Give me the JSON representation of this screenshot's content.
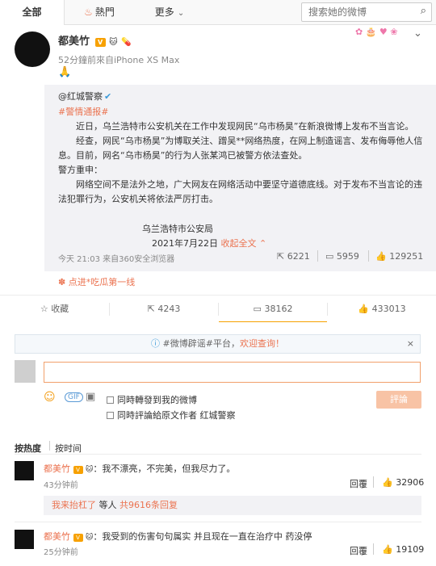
{
  "header": {
    "tabs": [
      {
        "label": "全部"
      },
      {
        "label": "熱門"
      },
      {
        "label": "更多"
      }
    ],
    "search_placeholder": "搜索她的微博"
  },
  "post": {
    "author": "都美竹",
    "meta": "52分鐘前來自iPhone XS Max",
    "text": "🙏",
    "repost": {
      "source": "@红城警察",
      "tag": "#警情通报#",
      "p1": "近日，乌兰浩特市公安机关在工作中发现网民“乌市杨昊”在新浪微博上发布不当言论。",
      "p2": "经查，网民“乌市杨昊”为博取关注、蹭吴**网络热度，在网上制造谣言、发布侮辱他人信息。目前，网名“乌市杨昊”的行为人张某鸿已被警方依法查处。",
      "p3": "警方重申：",
      "p4": "网络空间不是法外之地，广大网友在网络活动中要坚守道德底线。对于发布不当言论的违法犯罪行为，公安机关将依法严厉打击。",
      "org": "乌兰浩特市公安局",
      "date": "2021年7月22日",
      "collapse": "收起全文",
      "time_source": "今天 21:03 来自360安全浏览器",
      "repost_count": "6221",
      "comment_count": "5959",
      "like_count": "129251"
    },
    "promo": "点进*吃瓜第一线"
  },
  "actions": {
    "fav": "收藏",
    "repost": "4243",
    "comment": "38162",
    "like": "433013"
  },
  "comment_box": {
    "notice_pre": "#微博辟谣#平台，",
    "notice_link": "欢迎查询！",
    "opt1": "同時轉發到我的微博",
    "opt2": "同時評論給原文作者 红城警察",
    "submit": "評論"
  },
  "sort": {
    "hot": "按热度",
    "time": "按时间"
  },
  "comments": [
    {
      "user": "都美竹",
      "text": "：我不漂亮，不完美，但我尽力了。",
      "time": "43分钟前",
      "reply": "回覆",
      "likes": "32906"
    },
    {
      "user": "都美竹",
      "text": "：我受到的伤害句句属实 并且现在一直在治疗中 药没停",
      "time": "25分钟前",
      "reply": "回覆",
      "likes": "19109"
    }
  ],
  "reply_summary": {
    "who": "我来抬杠了",
    "mid": " 等人 ",
    "count": "共9616条回复"
  },
  "colors": {
    "accent": "#eb7350",
    "verified": "#f7a100",
    "blue_v": "#3a9ad9"
  }
}
